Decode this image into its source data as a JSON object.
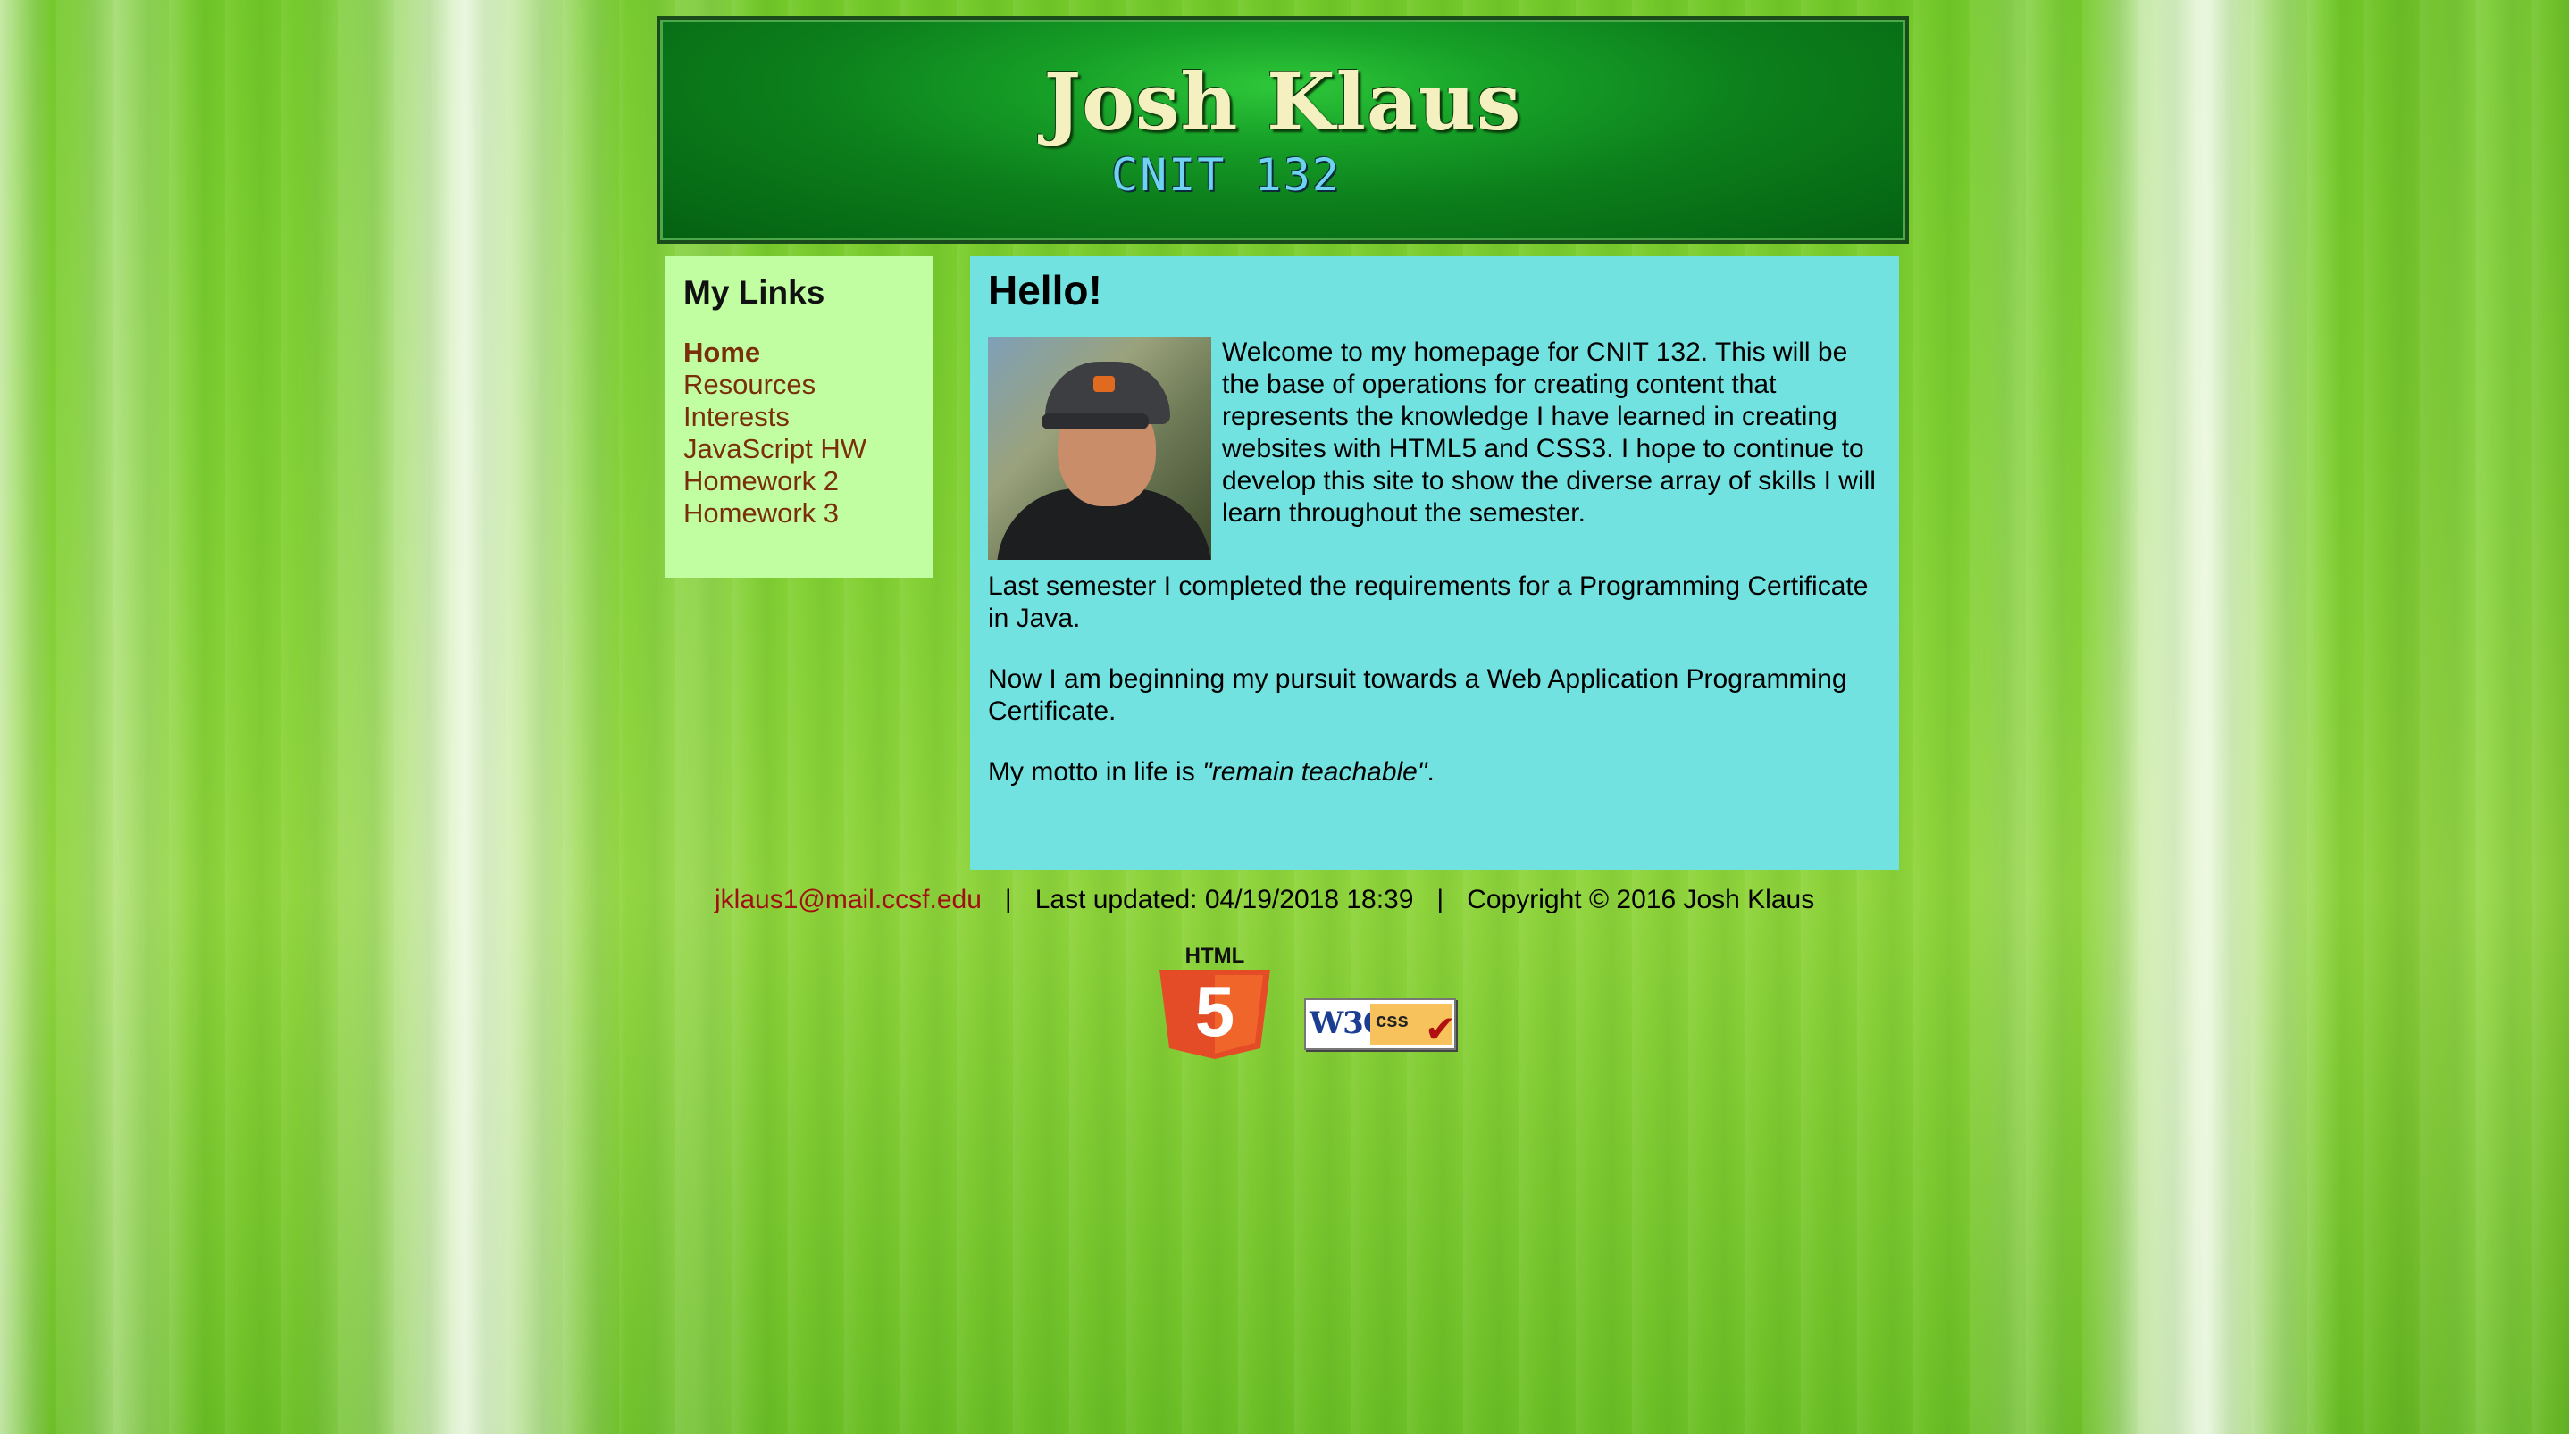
{
  "header": {
    "title": "Josh Klaus",
    "subtitle": "CNIT 132"
  },
  "sidebar": {
    "heading": "My Links",
    "items": [
      {
        "label": "Home"
      },
      {
        "label": "Resources"
      },
      {
        "label": "Interests"
      },
      {
        "label": "JavaScript HW"
      },
      {
        "label": "Homework 2"
      },
      {
        "label": "Homework 3"
      }
    ]
  },
  "main": {
    "heading": "Hello!",
    "intro": "Welcome to my homepage for CNIT 132. This will be the base of operations for creating content that represents the knowledge I have learned in creating websites with HTML5 and CSS3. I hope to continue to develop this site to show the diverse array of skills I will learn throughout the semester.",
    "paragraph2": "Last semester I completed the requirements for a Programming Certificate in Java.",
    "paragraph3": "Now I am beginning my pursuit towards a Web Application Programming Certificate.",
    "motto_prefix": "My motto in life is ",
    "motto": "\"remain teachable\"",
    "motto_suffix": "."
  },
  "footer": {
    "email": "jklaus1@mail.ccsf.edu",
    "separator": "|",
    "last_updated": "Last updated: 04/19/2018 18:39",
    "copyright": "Copyright © 2016 Josh Klaus"
  },
  "badges": {
    "html5_label": "HTML",
    "html5_number": "5",
    "w3c_label": "W3C",
    "css_label": "css"
  },
  "colors": {
    "sidebar_bg": "#c1fda1",
    "content_bg": "#72e2e0",
    "link": "#7a2f0a",
    "email_link": "#a01010",
    "header_green": "#0c7e1b",
    "title_color": "#f5f0bf",
    "subtitle_color": "#6fd2f0"
  }
}
